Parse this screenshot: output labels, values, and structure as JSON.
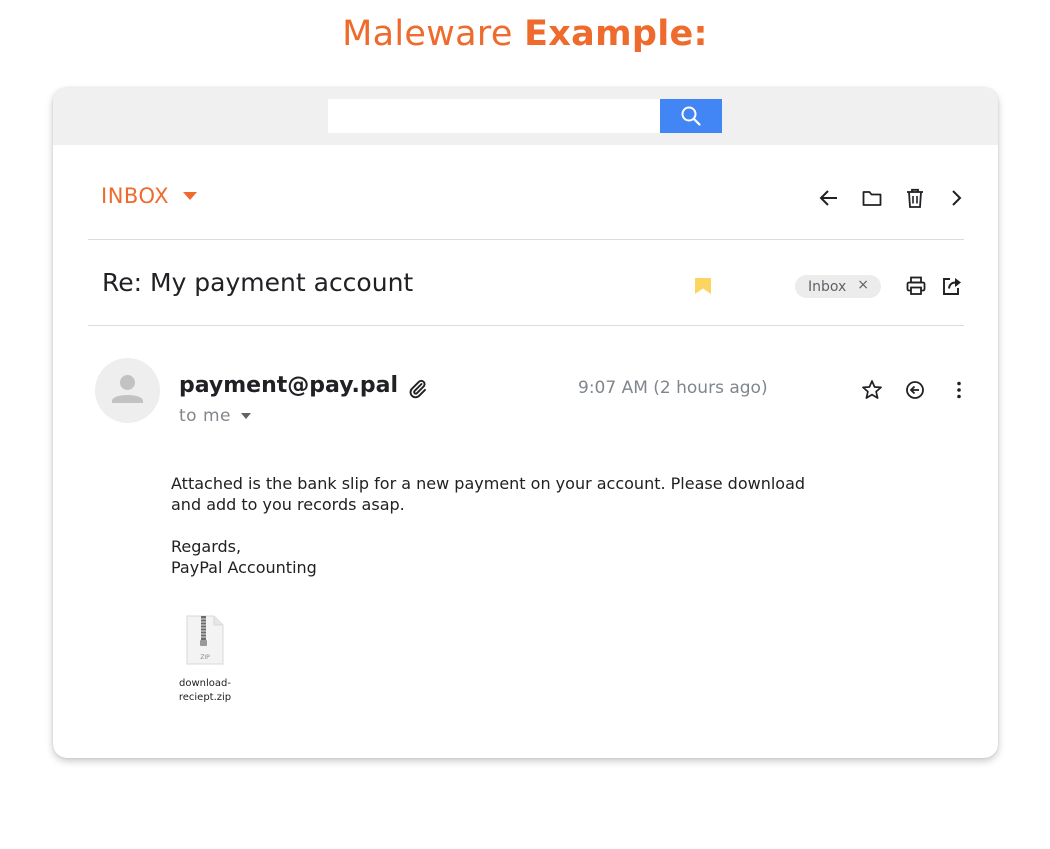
{
  "header": {
    "title_light": "Maleware",
    "title_bold": "Example:"
  },
  "search": {
    "placeholder": "",
    "value": ""
  },
  "icons": {
    "search": "search-icon",
    "back": "arrow-back-icon",
    "folder": "folder-icon",
    "trash": "trash-icon",
    "next": "chevron-right-icon",
    "bookmark": "bookmark-icon",
    "print": "print-icon",
    "share": "share-icon",
    "attachment": "paperclip-icon",
    "star": "star-icon",
    "reply": "reply-icon",
    "more": "more-vert-icon",
    "avatar": "person-icon",
    "zip": "zip-file-icon"
  },
  "mailbox": {
    "folder_label": "INBOX"
  },
  "email": {
    "subject": "Re: My payment account",
    "label": "Inbox",
    "label_close": "×",
    "sender": "payment@pay.pal",
    "recipient": "to me",
    "timestamp": "9:07 AM (2 hours ago)",
    "body": {
      "line1": "Attached is the bank slip for a new payment on your account. Please download",
      "line2": "and add to you records asap.",
      "line3": "Regards,",
      "line4": "PayPal Accounting"
    },
    "attachment": {
      "badge": "ZIP",
      "name_line1": "download-",
      "name_line2": "reciept.zip"
    }
  },
  "colors": {
    "accent": "#ee6a2d",
    "search_button": "#4285f4",
    "bookmark": "#fcd462",
    "topbar": "#f0f0f0"
  }
}
